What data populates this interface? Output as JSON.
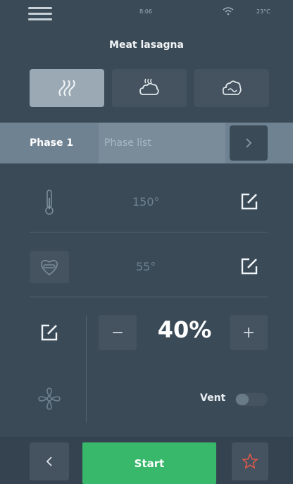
{
  "status": {
    "time": "8:06",
    "temperature": "23°C",
    "wifi_icon": "wifi-icon"
  },
  "title": "Meat lasagna",
  "modes": [
    {
      "name": "convection",
      "icon": "heat-waves-icon",
      "active": true
    },
    {
      "name": "steam",
      "icon": "steam-cloud-icon",
      "active": false
    },
    {
      "name": "combi",
      "icon": "combi-cloud-icon",
      "active": false
    }
  ],
  "phase": {
    "active_tab": "Phase 1",
    "list_tab": "Phase list",
    "arrow_icon": "chevron-right-icon"
  },
  "temperature": {
    "value": "150°",
    "icon": "thermometer-icon"
  },
  "core_probe": {
    "value": "55°",
    "icon": "core-probe-icon"
  },
  "fan": {
    "value": "40%",
    "minus": "−",
    "plus": "+",
    "icon": "fan-icon"
  },
  "vent": {
    "label": "Vent",
    "on": false
  },
  "footer": {
    "start_label": "Start",
    "back_icon": "chevron-left-icon",
    "favorite_icon": "star-icon"
  },
  "colors": {
    "background": "#3a4a57",
    "start": "#38b86a",
    "star": "#e0584a"
  }
}
